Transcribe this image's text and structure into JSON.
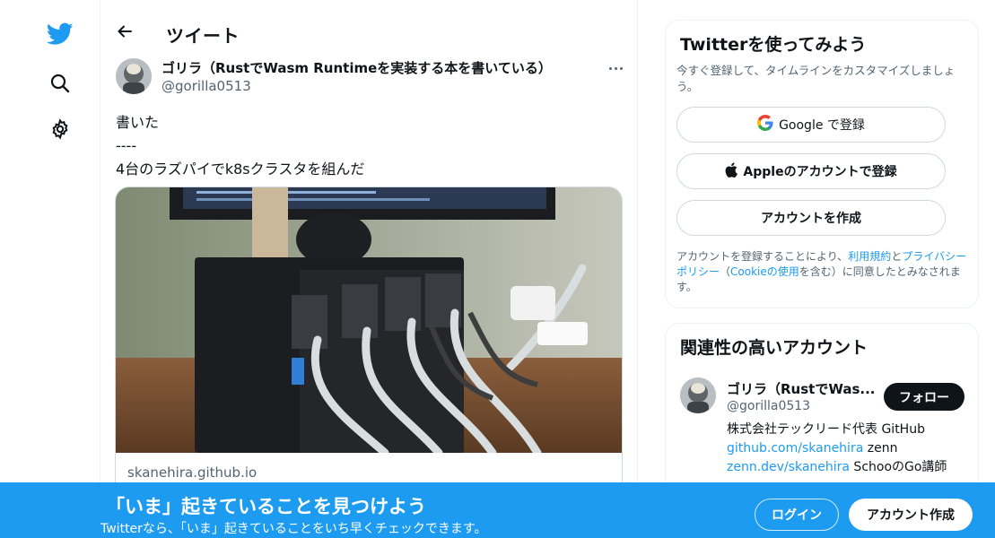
{
  "nav": {
    "logo_icon": "twitter-bird-icon",
    "search_icon": "search-icon",
    "settings_icon": "gear-icon"
  },
  "header": {
    "title": "ツイート"
  },
  "tweet": {
    "author_name": "ゴリラ（RustでWasm Runtimeを実装する本を書いている）",
    "author_handle": "@gorilla0513",
    "text": "書いた\n----\n4台のラズパイでk8sクラスタを組んだ",
    "card_domain": "skanehira.github.io"
  },
  "signup_box": {
    "title": "Twitterを使ってみよう",
    "subtitle": "今すぐ登録して、タイムラインをカスタマイズしましょう。",
    "google_button": "Google で登録",
    "apple_button": "Appleのアカウントで登録",
    "create_button": "アカウントを作成",
    "legal_prefix": "アカウントを登録することにより、",
    "terms_link": "利用規約",
    "and": "と",
    "privacy_link": "プライバシーポリシー",
    "paren_open": "（",
    "cookie_link": "Cookieの使用",
    "legal_suffix": "を含む）に同意したとみなされます。"
  },
  "related": {
    "title": "関連性の高いアカウント",
    "name": "ゴリラ（RustでWas...",
    "handle": "@gorilla0513",
    "follow_button": "フォロー",
    "bio_line1": "株式会社テックリード代表 GitHub",
    "bio_link1": "github.com/skanehira",
    "bio_text2": " zenn",
    "bio_link2": "zenn.dev/skanehira",
    "bio_text3": " SchooのGo講師"
  },
  "banner": {
    "title": "「いま」起きていることを見つけよう",
    "subtitle": "Twitterなら、「いま」起きていることをいち早くチェックできます。",
    "login_button": "ログイン",
    "signup_button": "アカウント作成"
  },
  "colors": {
    "brand": "#1d9bf0",
    "text": "#0f1419",
    "muted": "#536471",
    "border": "#cfd9de"
  }
}
